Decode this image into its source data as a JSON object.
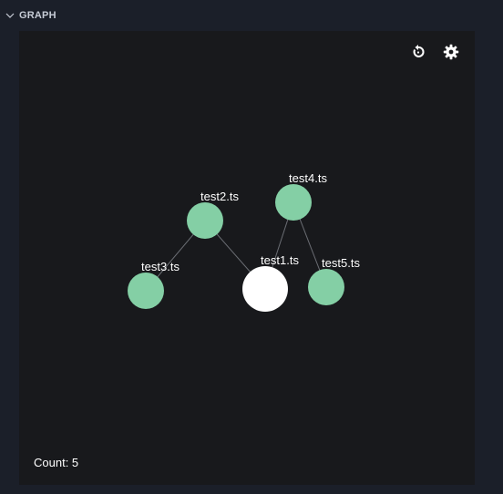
{
  "header": {
    "title": "GRAPH",
    "chevron_icon": "chevron-down-icon"
  },
  "toolbar": {
    "refresh_icon": "refresh-icon",
    "settings_icon": "gear-icon"
  },
  "graph": {
    "nodes": [
      {
        "id": "test1.ts",
        "label": "test1.ts",
        "active": true
      },
      {
        "id": "test2.ts",
        "label": "test2.ts",
        "active": false
      },
      {
        "id": "test3.ts",
        "label": "test3.ts",
        "active": false
      },
      {
        "id": "test4.ts",
        "label": "test4.ts",
        "active": false
      },
      {
        "id": "test5.ts",
        "label": "test5.ts",
        "active": false
      }
    ],
    "edges": [
      [
        "test2.ts",
        "test3.ts"
      ],
      [
        "test2.ts",
        "test1.ts"
      ],
      [
        "test4.ts",
        "test1.ts"
      ],
      [
        "test4.ts",
        "test5.ts"
      ]
    ]
  },
  "colors": {
    "node_default": "#84cfa5",
    "node_active": "#ffffff",
    "edge": "#6b6e74",
    "canvas": "#18191c"
  },
  "footer": {
    "count_text": "Count: 5"
  }
}
